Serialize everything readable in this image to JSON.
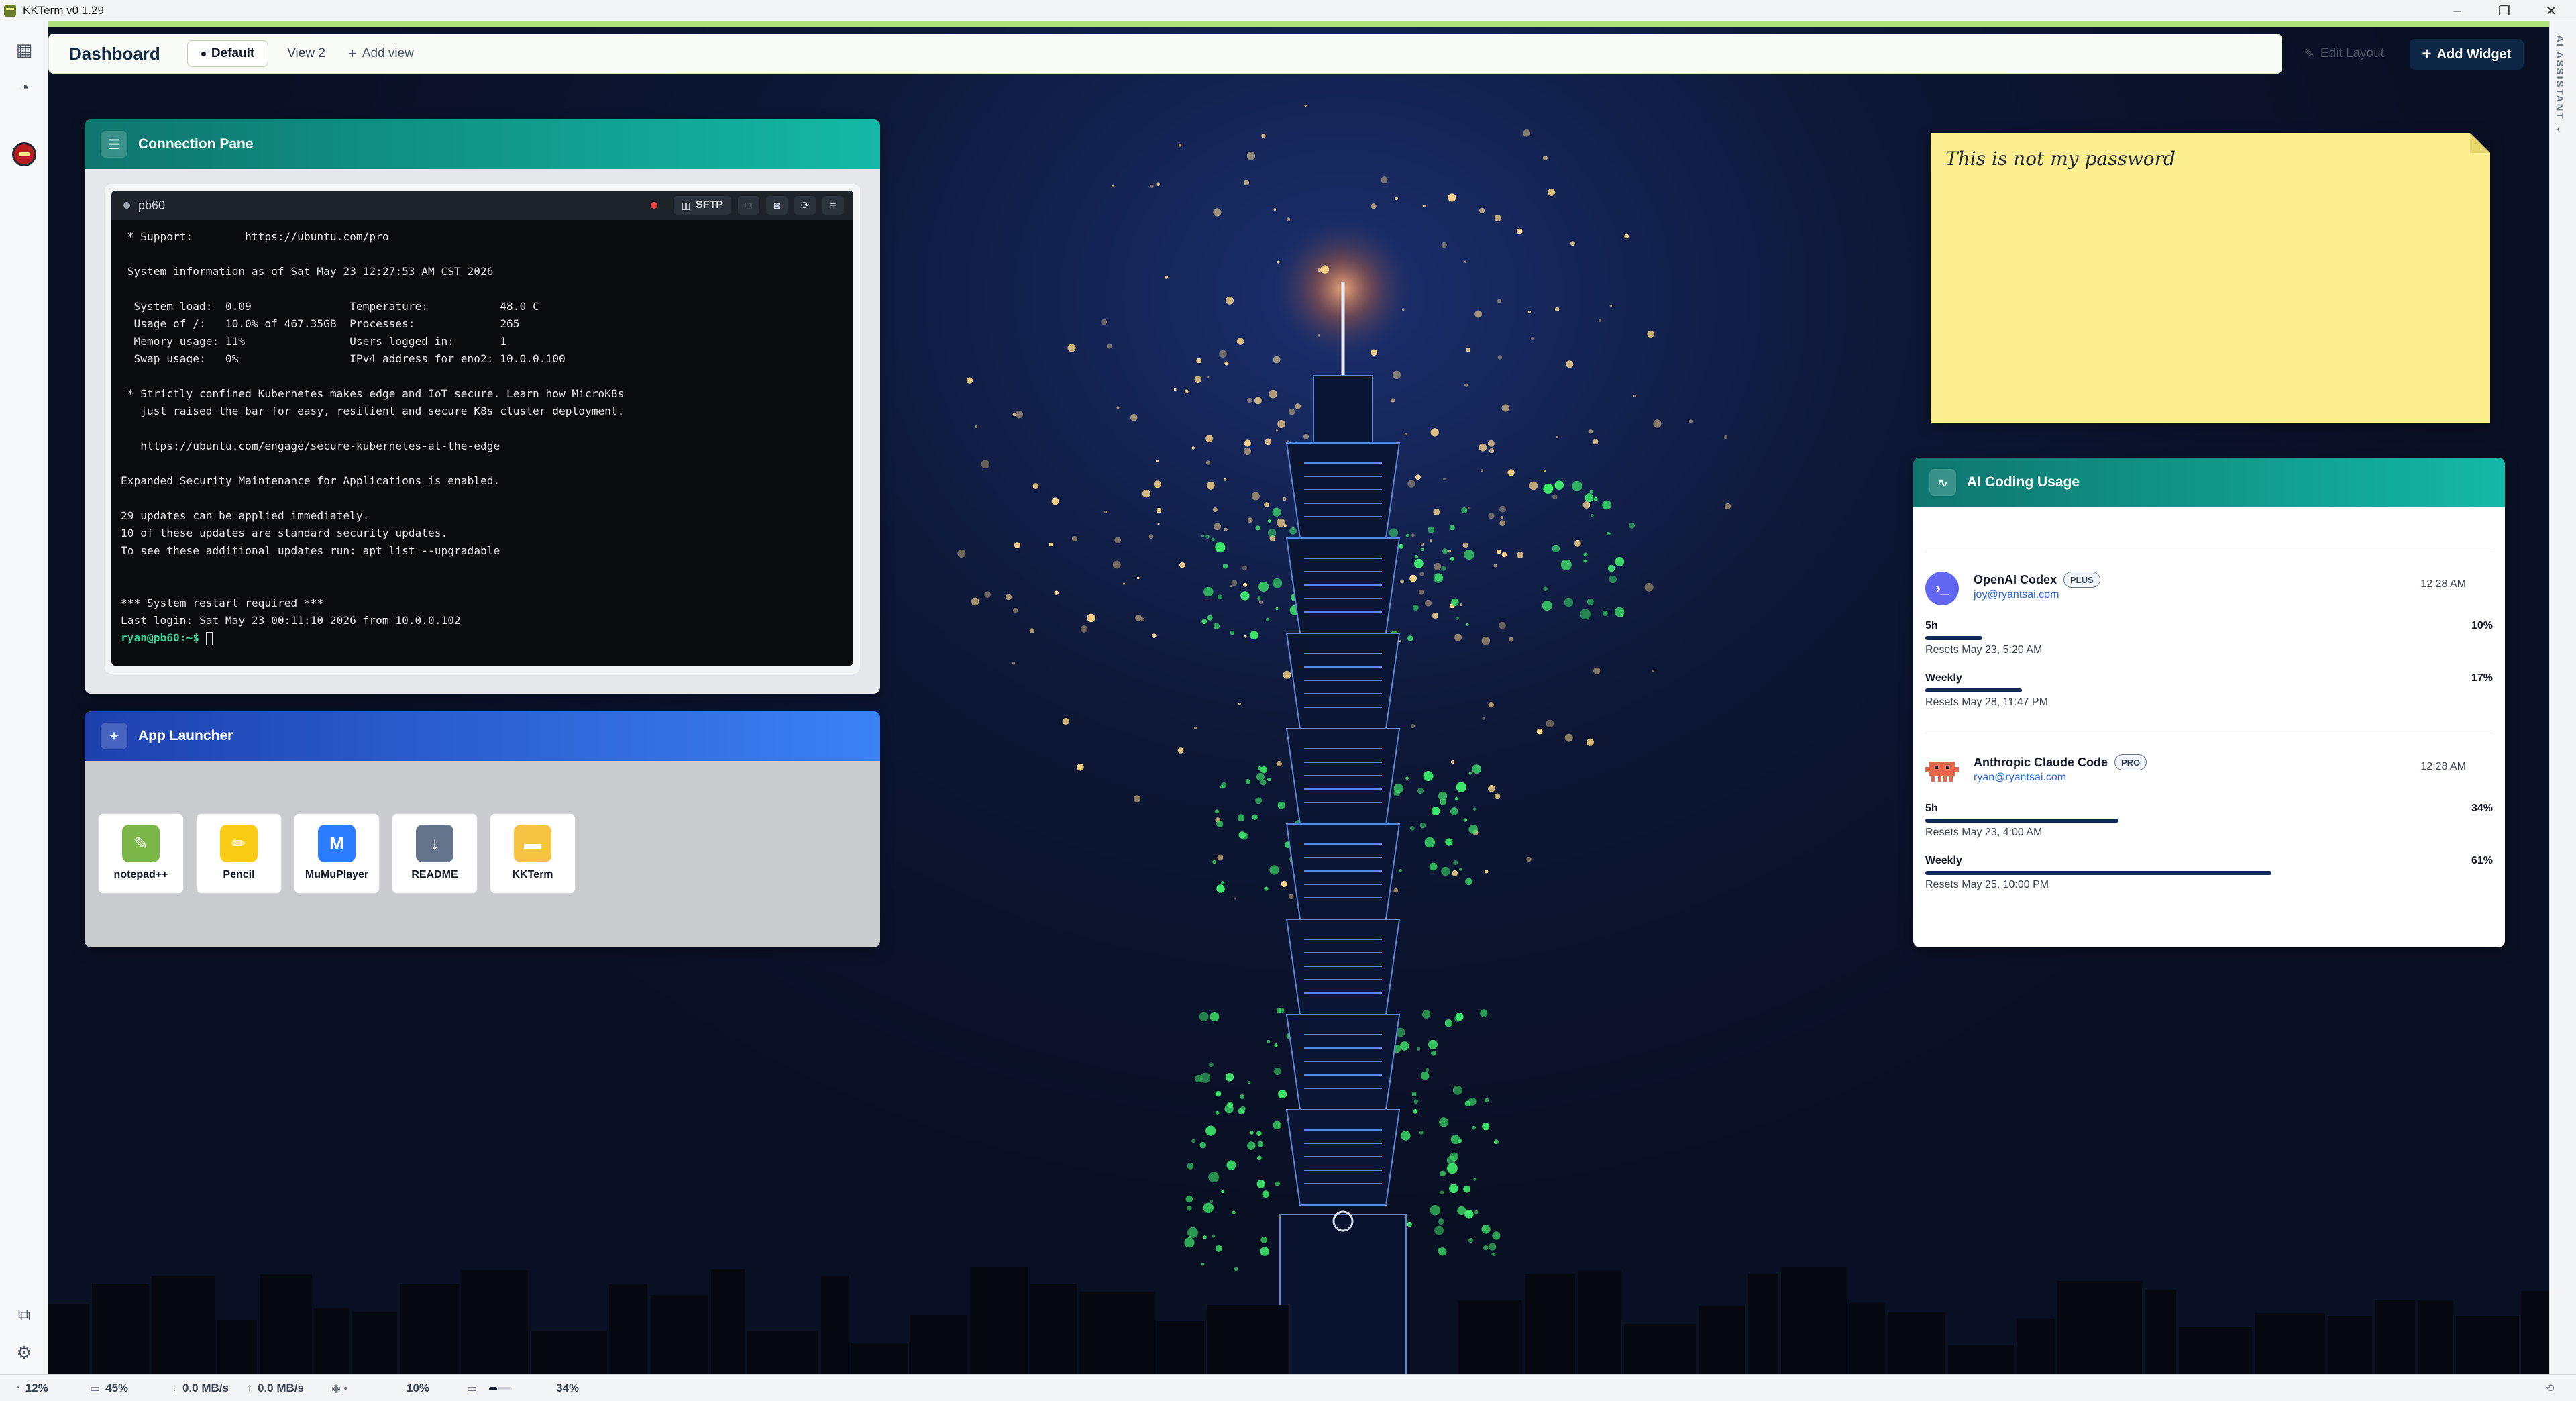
{
  "window": {
    "title": "KKTerm v0.1.29",
    "controls": [
      "minimize-icon",
      "restore-icon",
      "close-icon"
    ]
  },
  "header": {
    "title": "Dashboard",
    "views": [
      "Default",
      "View 2"
    ],
    "add_view": "Add view",
    "edit_layout": "Edit Layout",
    "add_widget": "Add Widget"
  },
  "right_rail": {
    "label": "AI ASSISTANT"
  },
  "connection_pane": {
    "title": "Connection Pane",
    "tab_name": "pb60",
    "sftp_label": "SFTP",
    "terminal_lines": [
      " * Support:        https://ubuntu.com/pro",
      "",
      " System information as of Sat May 23 12:27:53 AM CST 2026",
      "",
      "  System load:  0.09               Temperature:           48.0 C",
      "  Usage of /:   10.0% of 467.35GB  Processes:             265",
      "  Memory usage: 11%                Users logged in:       1",
      "  Swap usage:   0%                 IPv4 address for eno2: 10.0.0.100",
      "",
      " * Strictly confined Kubernetes makes edge and IoT secure. Learn how MicroK8s",
      "   just raised the bar for easy, resilient and secure K8s cluster deployment.",
      "",
      "   https://ubuntu.com/engage/secure-kubernetes-at-the-edge",
      "",
      "Expanded Security Maintenance for Applications is enabled.",
      "",
      "29 updates can be applied immediately.",
      "10 of these updates are standard security updates.",
      "To see these additional updates run: apt list --upgradable",
      "",
      "",
      "*** System restart required ***",
      "Last login: Sat May 23 00:11:10 2026 from 10.0.0.102"
    ],
    "prompt": "ryan@pb60:~$"
  },
  "app_launcher": {
    "title": "App Launcher",
    "apps": [
      {
        "name": "notepad++",
        "icon": "notepad-icon",
        "color": "#7ab648"
      },
      {
        "name": "Pencil",
        "icon": "pencil-icon",
        "color": "#facc15"
      },
      {
        "name": "MuMuPlayer",
        "icon": "mumu-icon",
        "color": "#2b7cff"
      },
      {
        "name": "README",
        "icon": "readme-icon",
        "color": "#64748b"
      },
      {
        "name": "KKTerm",
        "icon": "folder-icon",
        "color": "#f6c343"
      }
    ]
  },
  "sticky_note": {
    "text": "This is not my password"
  },
  "ai_usage": {
    "title": "AI Coding Usage",
    "providers": [
      {
        "name": "OpenAI Codex",
        "plan": "PLUS",
        "email": "joy@ryantsai.com",
        "time": "12:28 AM",
        "logo_color": "#6366f1",
        "meters": [
          {
            "label": "5h",
            "percent": 10,
            "percent_text": "10%",
            "reset": "Resets May 23, 5:20 AM"
          },
          {
            "label": "Weekly",
            "percent": 17,
            "percent_text": "17%",
            "reset": "Resets May 28, 11:47 PM"
          }
        ]
      },
      {
        "name": "Anthropic Claude Code",
        "plan": "PRO",
        "email": "ryan@ryantsai.com",
        "time": "12:28 AM",
        "logo_color": "#e0684b",
        "meters": [
          {
            "label": "5h",
            "percent": 34,
            "percent_text": "34%",
            "reset": "Resets May 23, 4:00 AM"
          },
          {
            "label": "Weekly",
            "percent": 61,
            "percent_text": "61%",
            "reset": "Resets May 25, 10:00 PM"
          }
        ]
      }
    ]
  },
  "status_bar": {
    "cpu": "12%",
    "memory": "45%",
    "download": "0.0 MB/s",
    "upload": "0.0 MB/s",
    "gpu": "10%",
    "gpu_mem": "34%"
  }
}
